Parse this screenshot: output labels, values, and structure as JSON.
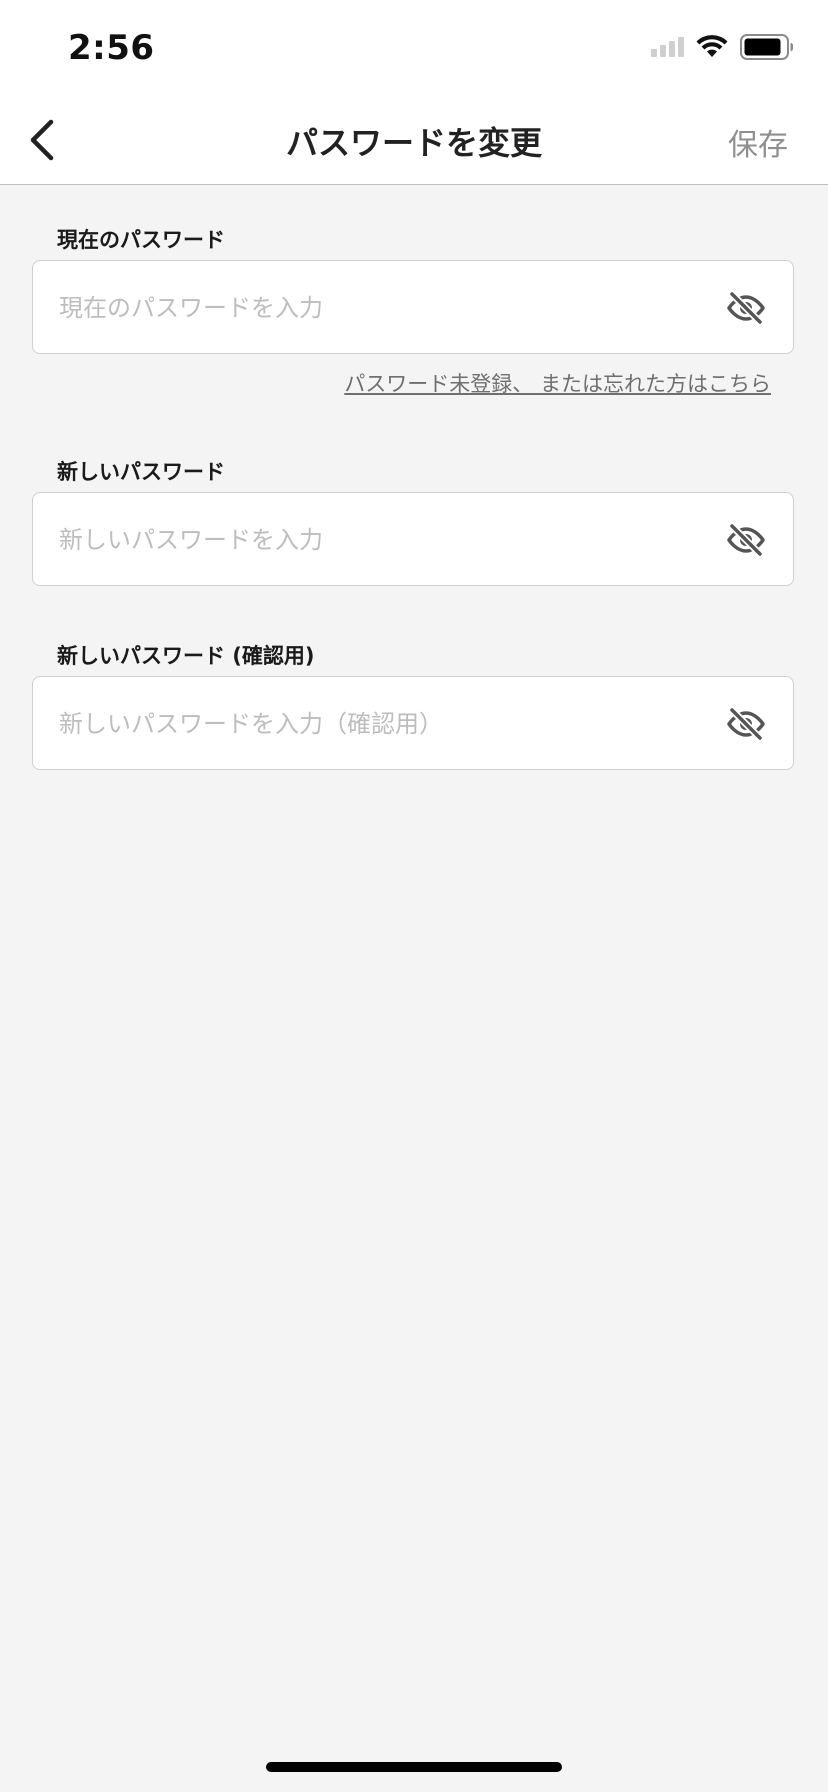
{
  "status_bar": {
    "time": "2:56"
  },
  "nav": {
    "title": "パスワードを変更",
    "save_label": "保存",
    "back_icon": "chevron-left-icon"
  },
  "fields": [
    {
      "label": "現在のパスワード",
      "placeholder": "現在のパスワードを入力",
      "value": "",
      "toggle_icon": "eye-off-icon"
    },
    {
      "label": "新しいパスワード",
      "placeholder": "新しいパスワードを入力",
      "value": "",
      "toggle_icon": "eye-off-icon"
    },
    {
      "label": "新しいパスワード (確認用)",
      "placeholder": "新しいパスワードを入力（確認用）",
      "value": "",
      "toggle_icon": "eye-off-icon"
    }
  ],
  "forgot_link": "パスワード未登録、 または忘れた方はこちら",
  "colors": {
    "background": "#f4f4f4",
    "surface": "#ffffff",
    "save_disabled": "#8f8f8f",
    "placeholder": "#bdbdbd"
  }
}
